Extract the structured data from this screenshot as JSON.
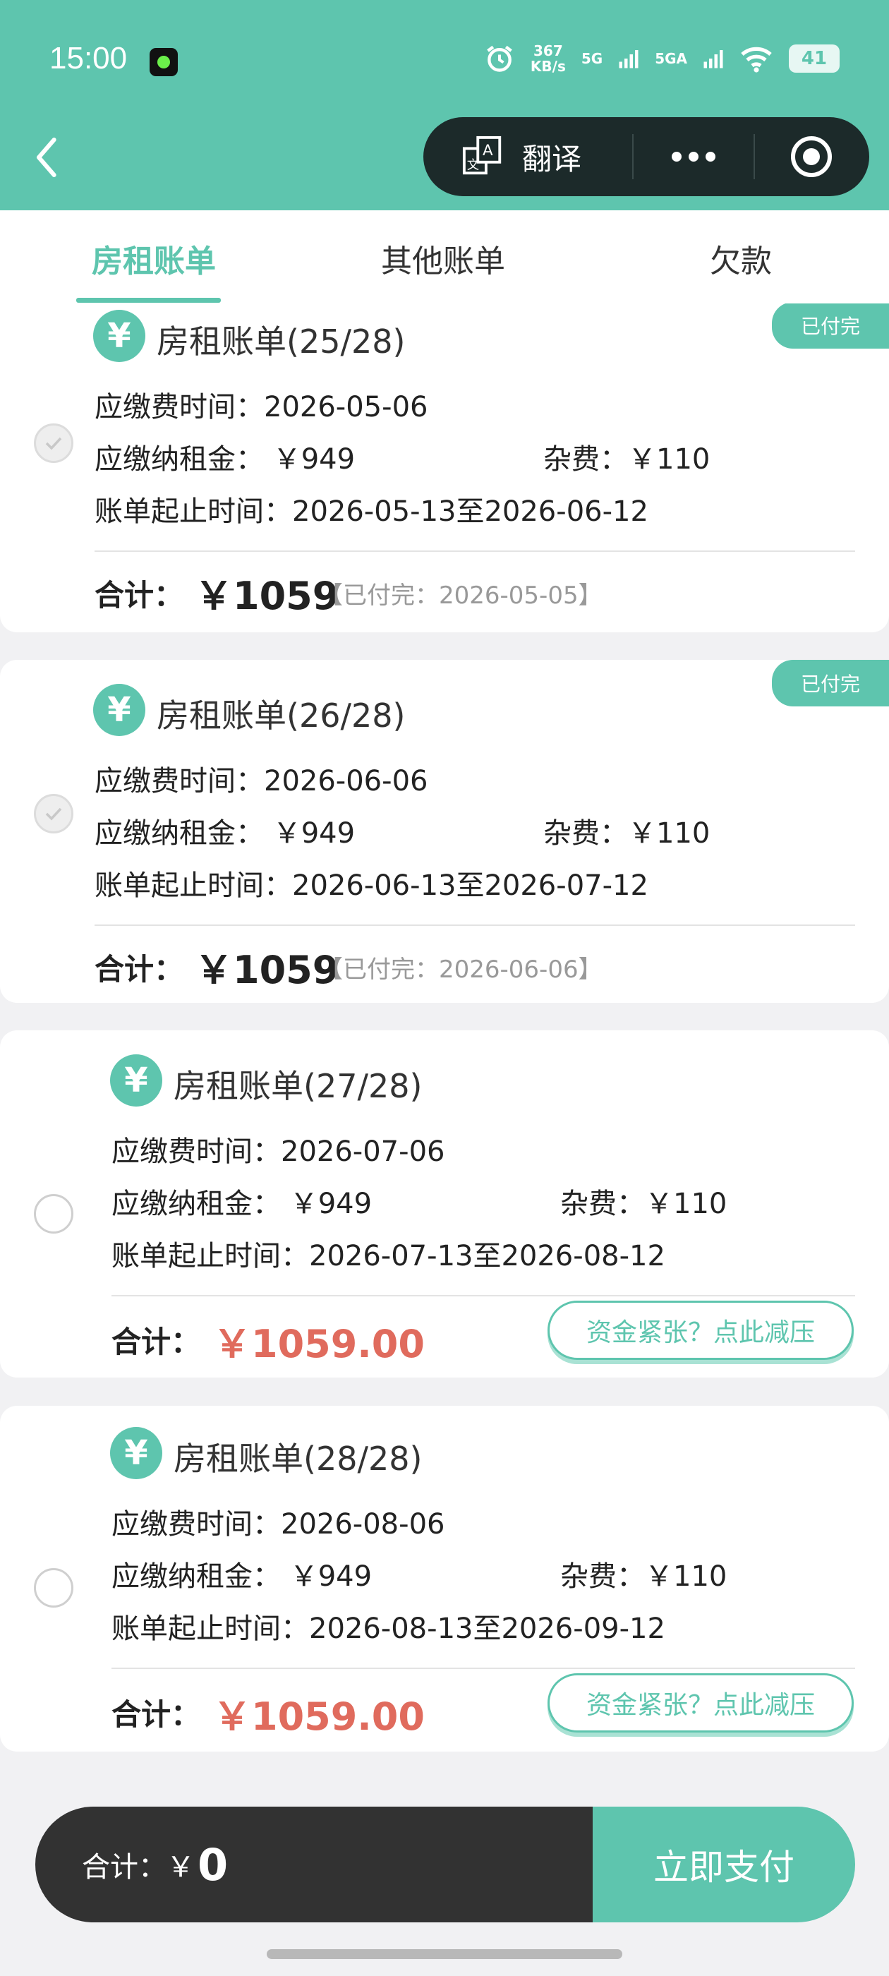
{
  "status_bar": {
    "time": "15:00",
    "speed_value": "367",
    "speed_unit": "KB/s",
    "net1": "5G",
    "net2": "5GA",
    "battery": "41"
  },
  "capsule": {
    "translate_label": "翻译"
  },
  "tabs": [
    {
      "label": "房租账单"
    },
    {
      "label": "其他账单"
    },
    {
      "label": "欠款"
    }
  ],
  "labels": {
    "due_time": "应缴费时间：",
    "rent": "应缴纳租金：",
    "misc": "杂费：",
    "period": "账单起止时间：",
    "total": "合计：",
    "relief": "资金紧张？点此减压",
    "paid_badge": "已付完"
  },
  "bills": [
    {
      "title": "房租账单(25/28)",
      "due_date": "2026-05-06",
      "rent": "￥949",
      "misc": "￥110",
      "period": "2026-05-13至2026-06-12",
      "total": "￥1059",
      "paid_note": "【已付完：2026-05-05】"
    },
    {
      "title": "房租账单(26/28)",
      "due_date": "2026-06-06",
      "rent": "￥949",
      "misc": "￥110",
      "period": "2026-06-13至2026-07-12",
      "total": "￥1059",
      "paid_note": "【已付完：2026-06-06】"
    },
    {
      "title": "房租账单(27/28)",
      "due_date": "2026-07-06",
      "rent": "￥949",
      "misc": "￥110",
      "period": "2026-07-13至2026-08-12",
      "total": "￥1059.00"
    },
    {
      "title": "房租账单(28/28)",
      "due_date": "2026-08-06",
      "rent": "￥949",
      "misc": "￥110",
      "period": "2026-08-13至2026-09-12",
      "total": "￥1059.00"
    }
  ],
  "footer": {
    "total_label": "合计：",
    "currency": "￥",
    "total_value": "0",
    "pay_button": "立即支付"
  },
  "colors": {
    "accent": "#5ec5ae",
    "red_amount": "#e06b5d",
    "dark_bar": "#323232"
  }
}
